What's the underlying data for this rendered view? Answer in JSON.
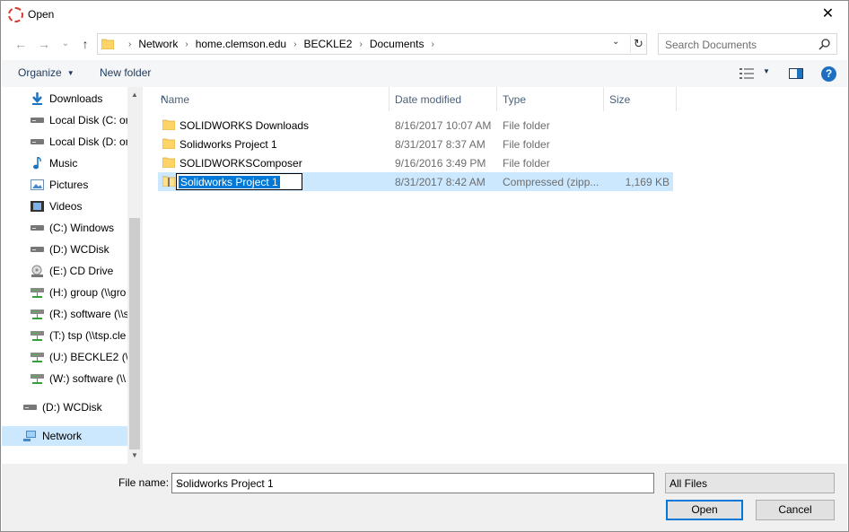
{
  "window": {
    "title": "Open",
    "close_glyph": "✕"
  },
  "nav_buttons": {
    "back": "←",
    "forward": "→",
    "recent": "⌄",
    "up": "↑"
  },
  "address": {
    "crumbs": [
      "Network",
      "home.clemson.edu",
      "BECKLE2",
      "Documents"
    ],
    "separator": "›",
    "dropdown_glyph": "⌄",
    "refresh_glyph": "↻"
  },
  "search": {
    "placeholder": "Search Documents"
  },
  "toolbar": {
    "organize": "Organize",
    "new_folder": "New folder",
    "help": "?"
  },
  "nav_pane": {
    "items": [
      {
        "label": "Downloads",
        "icon": "download-icon"
      },
      {
        "label": "Local Disk (C: on",
        "icon": "drive-icon"
      },
      {
        "label": "Local Disk (D: on",
        "icon": "drive-icon"
      },
      {
        "label": "Music",
        "icon": "music-icon"
      },
      {
        "label": "Pictures",
        "icon": "pictures-icon"
      },
      {
        "label": "Videos",
        "icon": "videos-icon"
      },
      {
        "label": "(C:) Windows",
        "icon": "drive-icon"
      },
      {
        "label": "(D:) WCDisk",
        "icon": "drive-icon"
      },
      {
        "label": "(E:) CD Drive",
        "icon": "cd-drive-icon"
      },
      {
        "label": "(H:) group (\\\\gro",
        "icon": "network-drive-icon"
      },
      {
        "label": "(R:) software (\\\\s",
        "icon": "network-drive-icon"
      },
      {
        "label": "(T:) tsp (\\\\tsp.cle",
        "icon": "network-drive-icon"
      },
      {
        "label": "(U:) BECKLE2 (\\\\",
        "icon": "network-drive-icon"
      },
      {
        "label": "(W:) software (\\\\",
        "icon": "network-drive-icon"
      },
      {
        "label": "(D:) WCDisk",
        "icon": "drive-icon"
      },
      {
        "label": "Network",
        "icon": "network-icon"
      }
    ],
    "scroll_up": "▲",
    "scroll_down": "▼"
  },
  "columns": {
    "name": "Name",
    "date": "Date modified",
    "type": "Type",
    "size": "Size",
    "sort_glyph": "^"
  },
  "files": [
    {
      "name": "SOLIDWORKS Downloads",
      "date": "8/16/2017 10:07 AM",
      "type": "File folder",
      "size": "",
      "icon": "folder-icon"
    },
    {
      "name": "Solidworks Project 1",
      "date": "8/31/2017 8:37 AM",
      "type": "File folder",
      "size": "",
      "icon": "folder-icon"
    },
    {
      "name": "SOLIDWORKSComposer",
      "date": "9/16/2016 3:49 PM",
      "type": "File folder",
      "size": "",
      "icon": "folder-icon"
    },
    {
      "name": "Solidworks Project 1",
      "date": "8/31/2017 8:42 AM",
      "type": "Compressed (zipp...",
      "size": "1,169 KB",
      "icon": "zip-folder-icon"
    }
  ],
  "bottom": {
    "file_name_label": "File name:",
    "file_name_value": "Solidworks Project 1",
    "file_type": "All Files",
    "dropdown_glyph": "⌄",
    "open": "Open",
    "cancel": "Cancel"
  },
  "colors": {
    "accent": "#0078d7",
    "selection": "#cce8ff",
    "folder": "#ffd466"
  }
}
